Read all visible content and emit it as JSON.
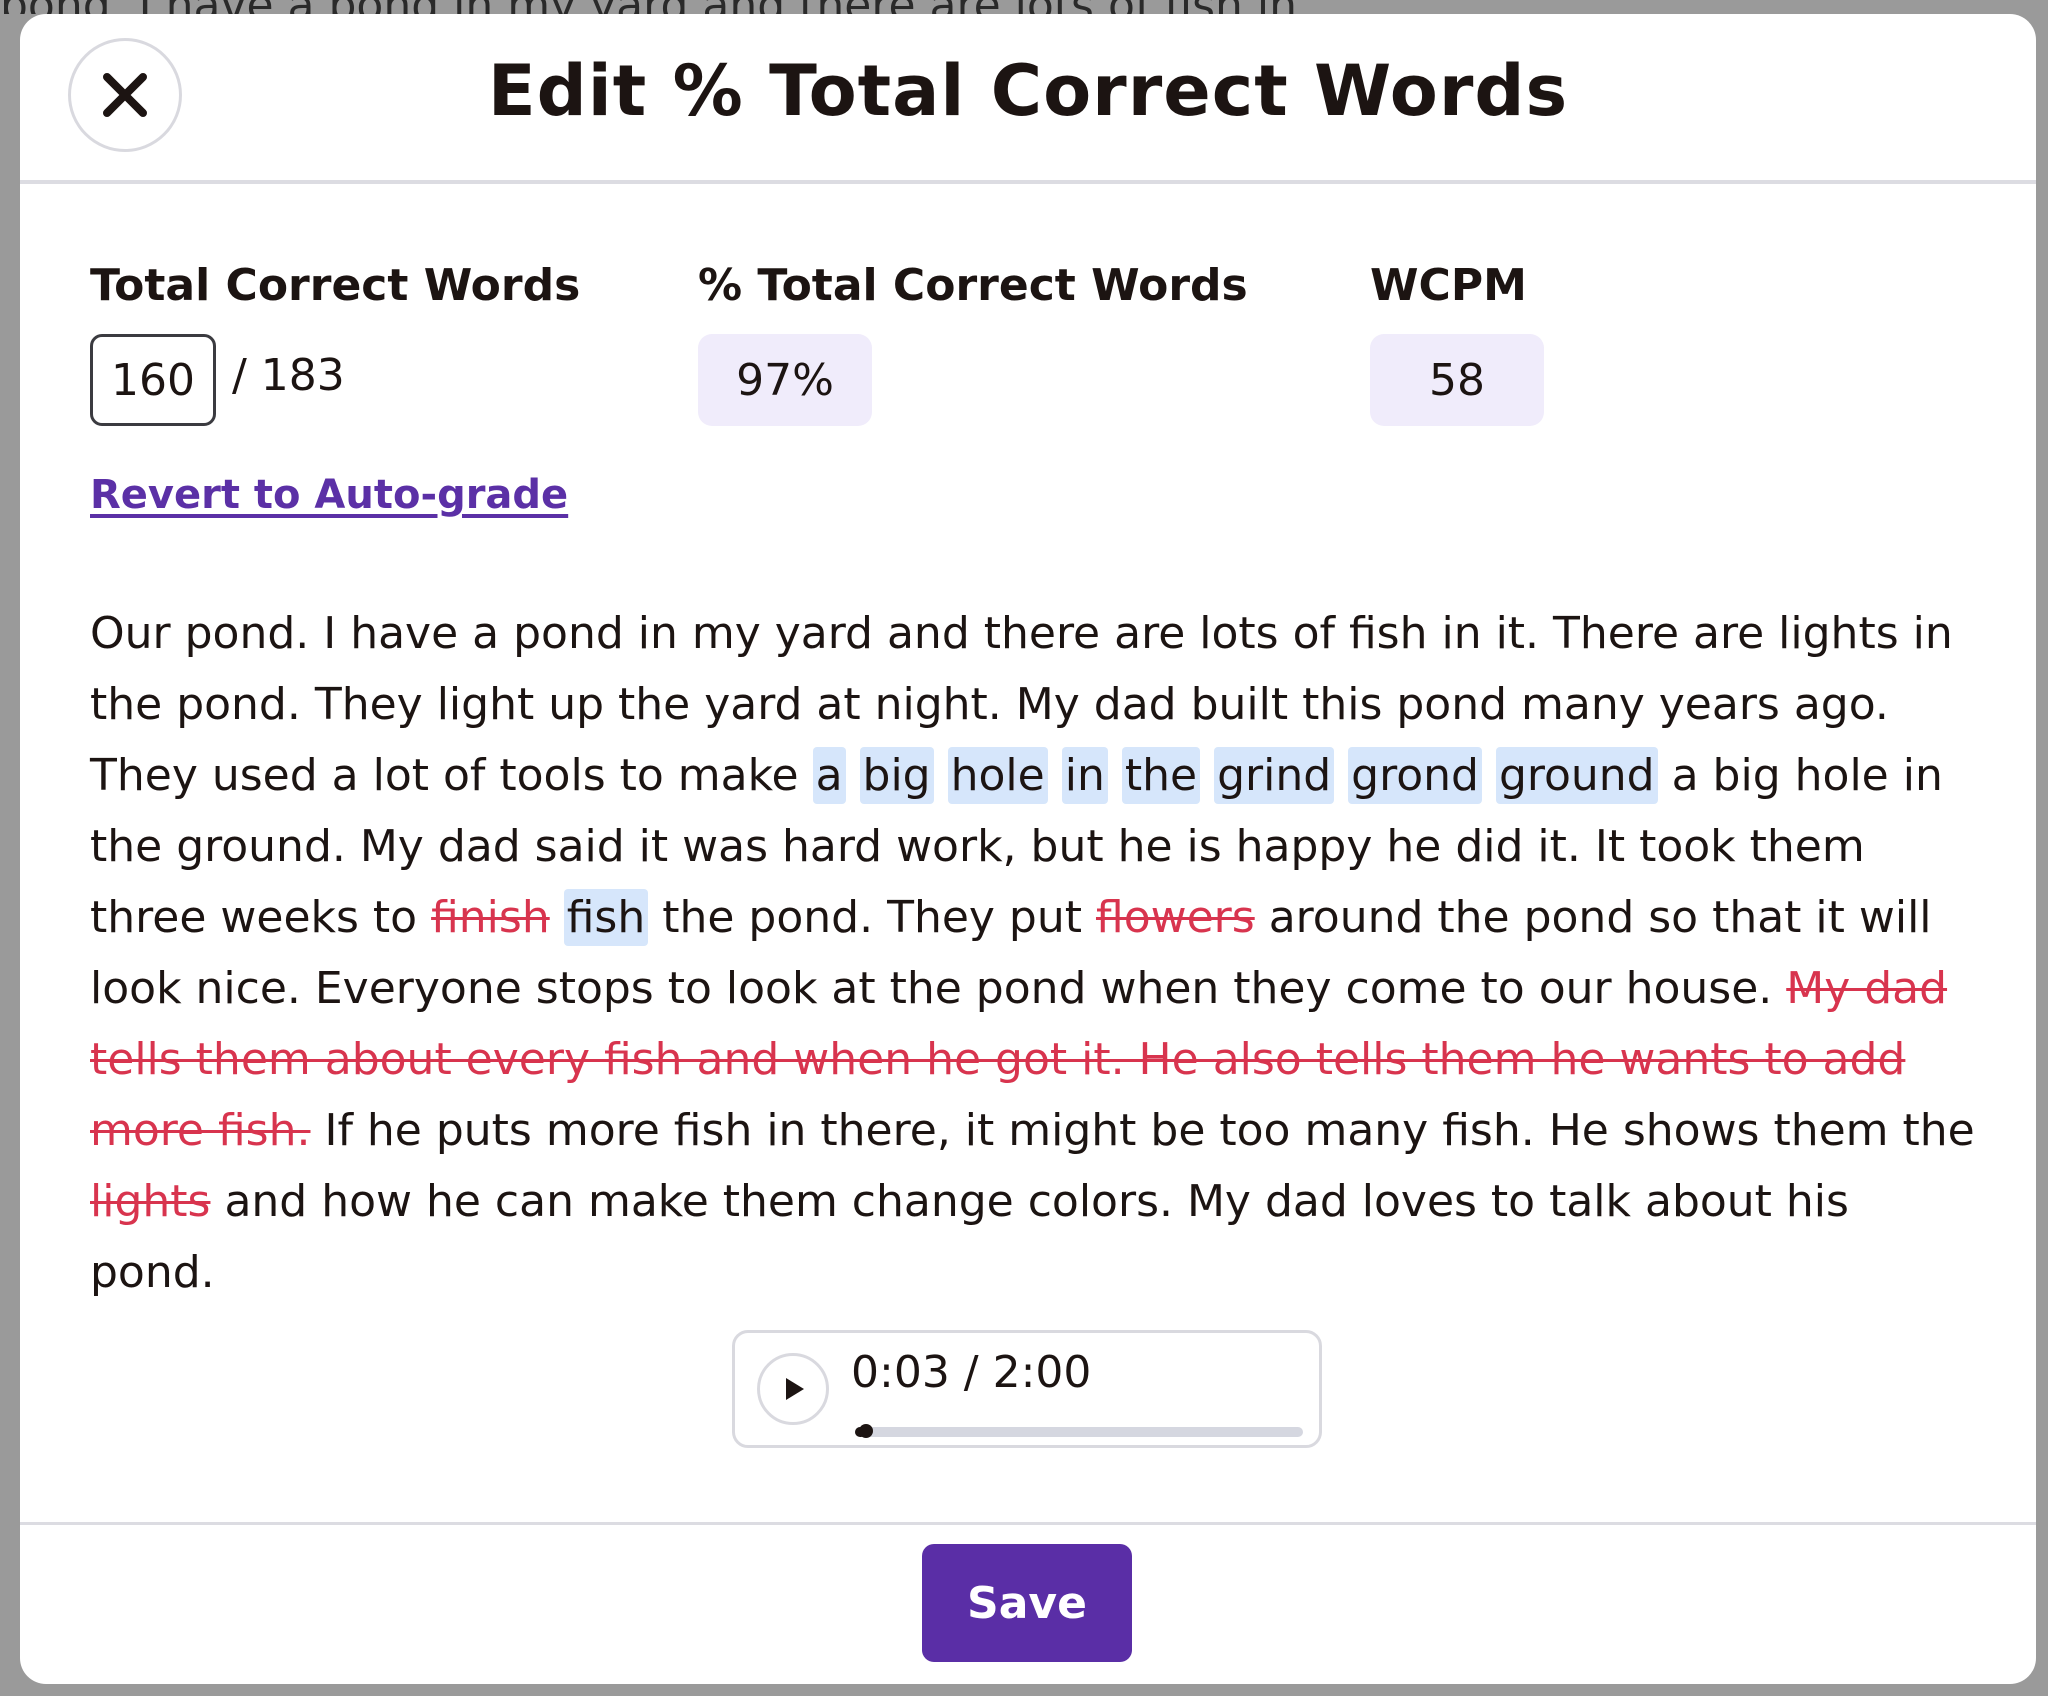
{
  "background": {
    "top_line_text": "pond. I have a pond in my yard and there are lots of fish in"
  },
  "modal": {
    "title": "Edit % Total Correct Words",
    "close_icon": "close-icon"
  },
  "stats": {
    "total_correct_words": {
      "label": "Total Correct Words",
      "value": "160",
      "total": "/ 183"
    },
    "percent_total_correct": {
      "label": "% Total Correct Words",
      "value": "97%"
    },
    "wcpm": {
      "label": "WCPM",
      "value": "58"
    }
  },
  "revert_link": "Revert to Auto-grade",
  "passage": {
    "segments": [
      {
        "text": "Our pond. I have a pond in my yard and there are lots of fish in it. There are lights in the pond. They light up the yard at night. My dad built this pond many years ago. They used a lot of tools to make ",
        "type": "normal"
      },
      {
        "text": "a",
        "type": "highlight"
      },
      {
        "text": " ",
        "type": "normal"
      },
      {
        "text": "big",
        "type": "highlight"
      },
      {
        "text": " ",
        "type": "normal"
      },
      {
        "text": "hole",
        "type": "highlight"
      },
      {
        "text": " ",
        "type": "normal"
      },
      {
        "text": "in",
        "type": "highlight"
      },
      {
        "text": " ",
        "type": "normal"
      },
      {
        "text": "the",
        "type": "highlight"
      },
      {
        "text": " ",
        "type": "normal"
      },
      {
        "text": "grind",
        "type": "highlight"
      },
      {
        "text": " ",
        "type": "normal"
      },
      {
        "text": "grond",
        "type": "highlight"
      },
      {
        "text": " ",
        "type": "normal"
      },
      {
        "text": "ground",
        "type": "highlight"
      },
      {
        "text": " a big hole in the ground. My dad said it was hard work, but he is happy he did it. It took them three weeks to ",
        "type": "normal"
      },
      {
        "text": "finish",
        "type": "deleted"
      },
      {
        "text": " ",
        "type": "normal"
      },
      {
        "text": "fish",
        "type": "highlight"
      },
      {
        "text": " the pond. They put ",
        "type": "normal"
      },
      {
        "text": "flowers",
        "type": "deleted"
      },
      {
        "text": " around the pond so that it will look nice. Everyone stops to look at the pond when they come to our house. ",
        "type": "normal"
      },
      {
        "text": "My dad tells them about every fish and when he got it. He also tells them he wants to add more fish.",
        "type": "deleted"
      },
      {
        "text": " If he puts more fish in there, it might be too many fish. He shows them the ",
        "type": "normal"
      },
      {
        "text": "lights",
        "type": "deleted"
      },
      {
        "text": " and how he can make them change colors. My dad loves to talk about his pond.",
        "type": "normal"
      }
    ]
  },
  "audio": {
    "time_display": "0:03 / 2:00",
    "progress_fraction": 0.025,
    "play_icon": "play-icon"
  },
  "save_label": "Save",
  "colors": {
    "accent": "#5a2ea6",
    "highlight": "#d6e6fb",
    "deleted": "#d8344e",
    "pill": "#f0ecfb",
    "text": "#1c1412"
  }
}
